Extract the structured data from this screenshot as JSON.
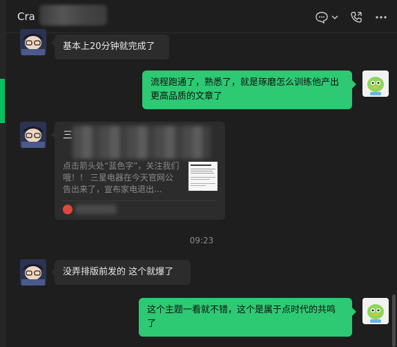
{
  "header": {
    "title": "Cra",
    "icons": [
      "chat-bubble-icon",
      "chevron-down-icon",
      "phone-icon",
      "more-icon"
    ]
  },
  "colors": {
    "background": "#1e1e1e",
    "incoming_bubble": "#2c2c2c",
    "outgoing_bubble": "#2ec973",
    "accent": "#07c160"
  },
  "messages": [
    {
      "direction": "in",
      "text": "基本上20分钟就完成了"
    },
    {
      "direction": "out",
      "text": "流程跑通了，熟悉了，就是琢磨怎么训练他产出更高品质的文章了"
    },
    {
      "direction": "in",
      "type": "article-card",
      "title": "三",
      "desc": "点击箭头处“蓝色字”，关注我们哦！！ 三星电器在今天官网公告出来了，宣布家电退出..."
    },
    {
      "direction": "in",
      "text": "没弄排版前发的 这个就爆了"
    },
    {
      "direction": "out",
      "text": "这个主题一看就不错，这个是属于点时代的共鸣了"
    }
  ],
  "timestamp": "09:23"
}
